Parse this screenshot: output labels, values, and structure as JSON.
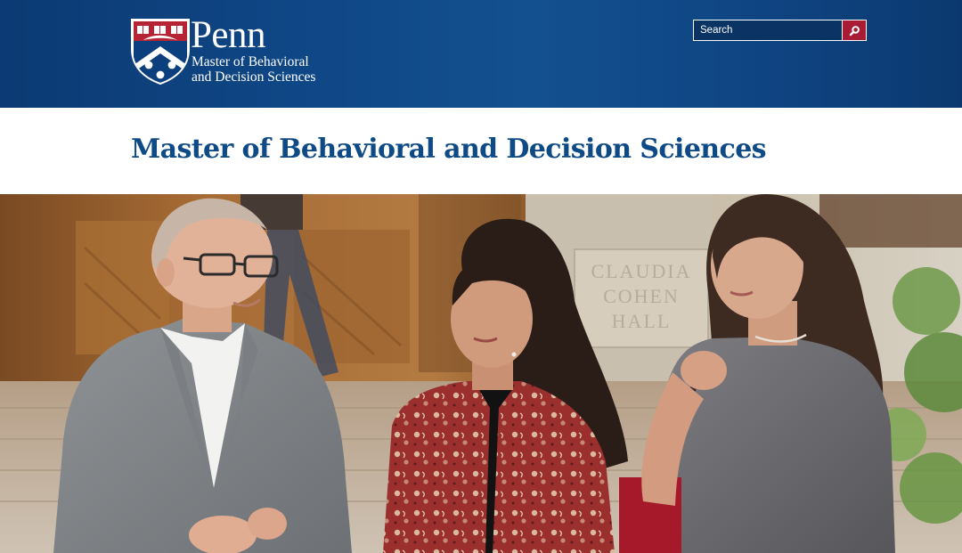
{
  "header": {
    "logo": {
      "wordmark": "Penn",
      "subtitle_line1": "Master of Behavioral",
      "subtitle_line2": "and Decision Sciences"
    },
    "search": {
      "placeholder": "Search",
      "button_icon": "search-icon"
    }
  },
  "page": {
    "title": "Master of Behavioral and Decision Sciences"
  },
  "hero": {
    "image": "Three people walking and talking outside a campus building",
    "engraved_text_line1": "CLAUDIA",
    "engraved_text_line2": "COHEN",
    "engraved_text_line3": "HALL"
  },
  "colors": {
    "header_blue": "#0f4685",
    "title_blue": "#0e4a85",
    "search_button_red": "#a81d35"
  }
}
